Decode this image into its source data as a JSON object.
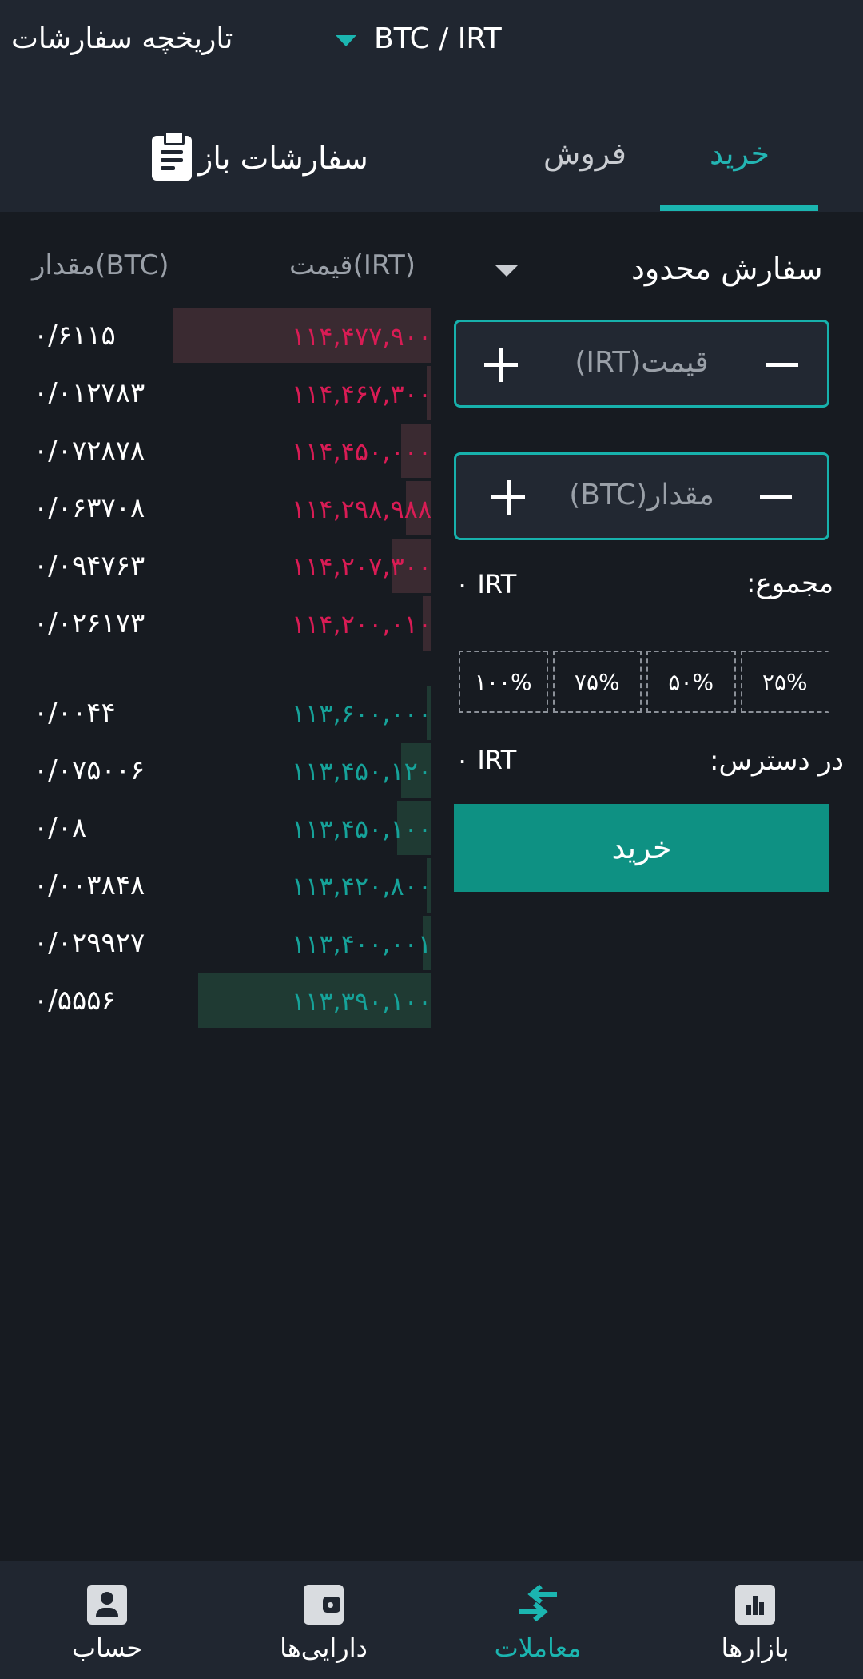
{
  "header": {
    "history_label": "تاریخچه سفارشات",
    "pair_label": "BTC / IRT"
  },
  "tabs": {
    "buy": "خرید",
    "sell": "فروش",
    "open_orders": "سفارشات باز"
  },
  "orderbook": {
    "price_header": "قیمت(IRT)",
    "qty_header": "مقدار(BTC)",
    "asks": [
      {
        "price": "۱۱۴,۴۷۷,۹۰۰",
        "qty": "۰/۶۱۱۵",
        "depth": 0.6
      },
      {
        "price": "۱۱۴,۴۶۷,۳۰۰",
        "qty": "۰/۰۱۲۷۸۳",
        "depth": 0.01
      },
      {
        "price": "۱۱۴,۴۵۰,۰۰۰",
        "qty": "۰/۰۷۲۸۷۸",
        "depth": 0.07
      },
      {
        "price": "۱۱۴,۲۹۸,۹۸۸",
        "qty": "۰/۰۶۳۷۰۸",
        "depth": 0.06
      },
      {
        "price": "۱۱۴,۲۰۷,۳۰۰",
        "qty": "۰/۰۹۴۷۶۳",
        "depth": 0.09
      },
      {
        "price": "۱۱۴,۲۰۰,۰۱۰",
        "qty": "۰/۰۲۶۱۷۳",
        "depth": 0.02
      }
    ],
    "bids": [
      {
        "price": "۱۱۳,۶۰۰,۰۰۰",
        "qty": "۰/۰۰۴۴",
        "depth": 0.0
      },
      {
        "price": "۱۱۳,۴۵۰,۱۲۰",
        "qty": "۰/۰۷۵۰۰۶",
        "depth": 0.07
      },
      {
        "price": "۱۱۳,۴۵۰,۱۰۰",
        "qty": "۰/۰۸",
        "depth": 0.08
      },
      {
        "price": "۱۱۳,۴۲۰,۸۰۰",
        "qty": "۰/۰۰۳۸۴۸",
        "depth": 0.0
      },
      {
        "price": "۱۱۳,۴۰۰,۰۰۱",
        "qty": "۰/۰۲۹۹۲۷",
        "depth": 0.02
      },
      {
        "price": "۱۱۳,۳۹۰,۱۰۰",
        "qty": "۰/۵۵۵۶",
        "depth": 0.54
      }
    ]
  },
  "form": {
    "order_type": "سفارش محدود",
    "price_placeholder": "قیمت(IRT)",
    "amount_placeholder": "مقدار(BTC)",
    "total_label": "مجموع:",
    "total_value": "۰ IRT",
    "percents": [
      "۱۰۰%",
      "۷۵%",
      "۵۰%",
      "۲۵%"
    ],
    "available_label": "در دسترس:",
    "available_value": "۰ IRT",
    "submit_label": "خرید"
  },
  "nav": {
    "account": "حساب",
    "assets": "دارایی‌ها",
    "trades": "معاملات",
    "markets": "بازارها"
  },
  "colors": {
    "accent": "#1bb5b0",
    "ask": "#d91c55",
    "bid": "#16a39a",
    "buy_button": "#0e9183"
  }
}
